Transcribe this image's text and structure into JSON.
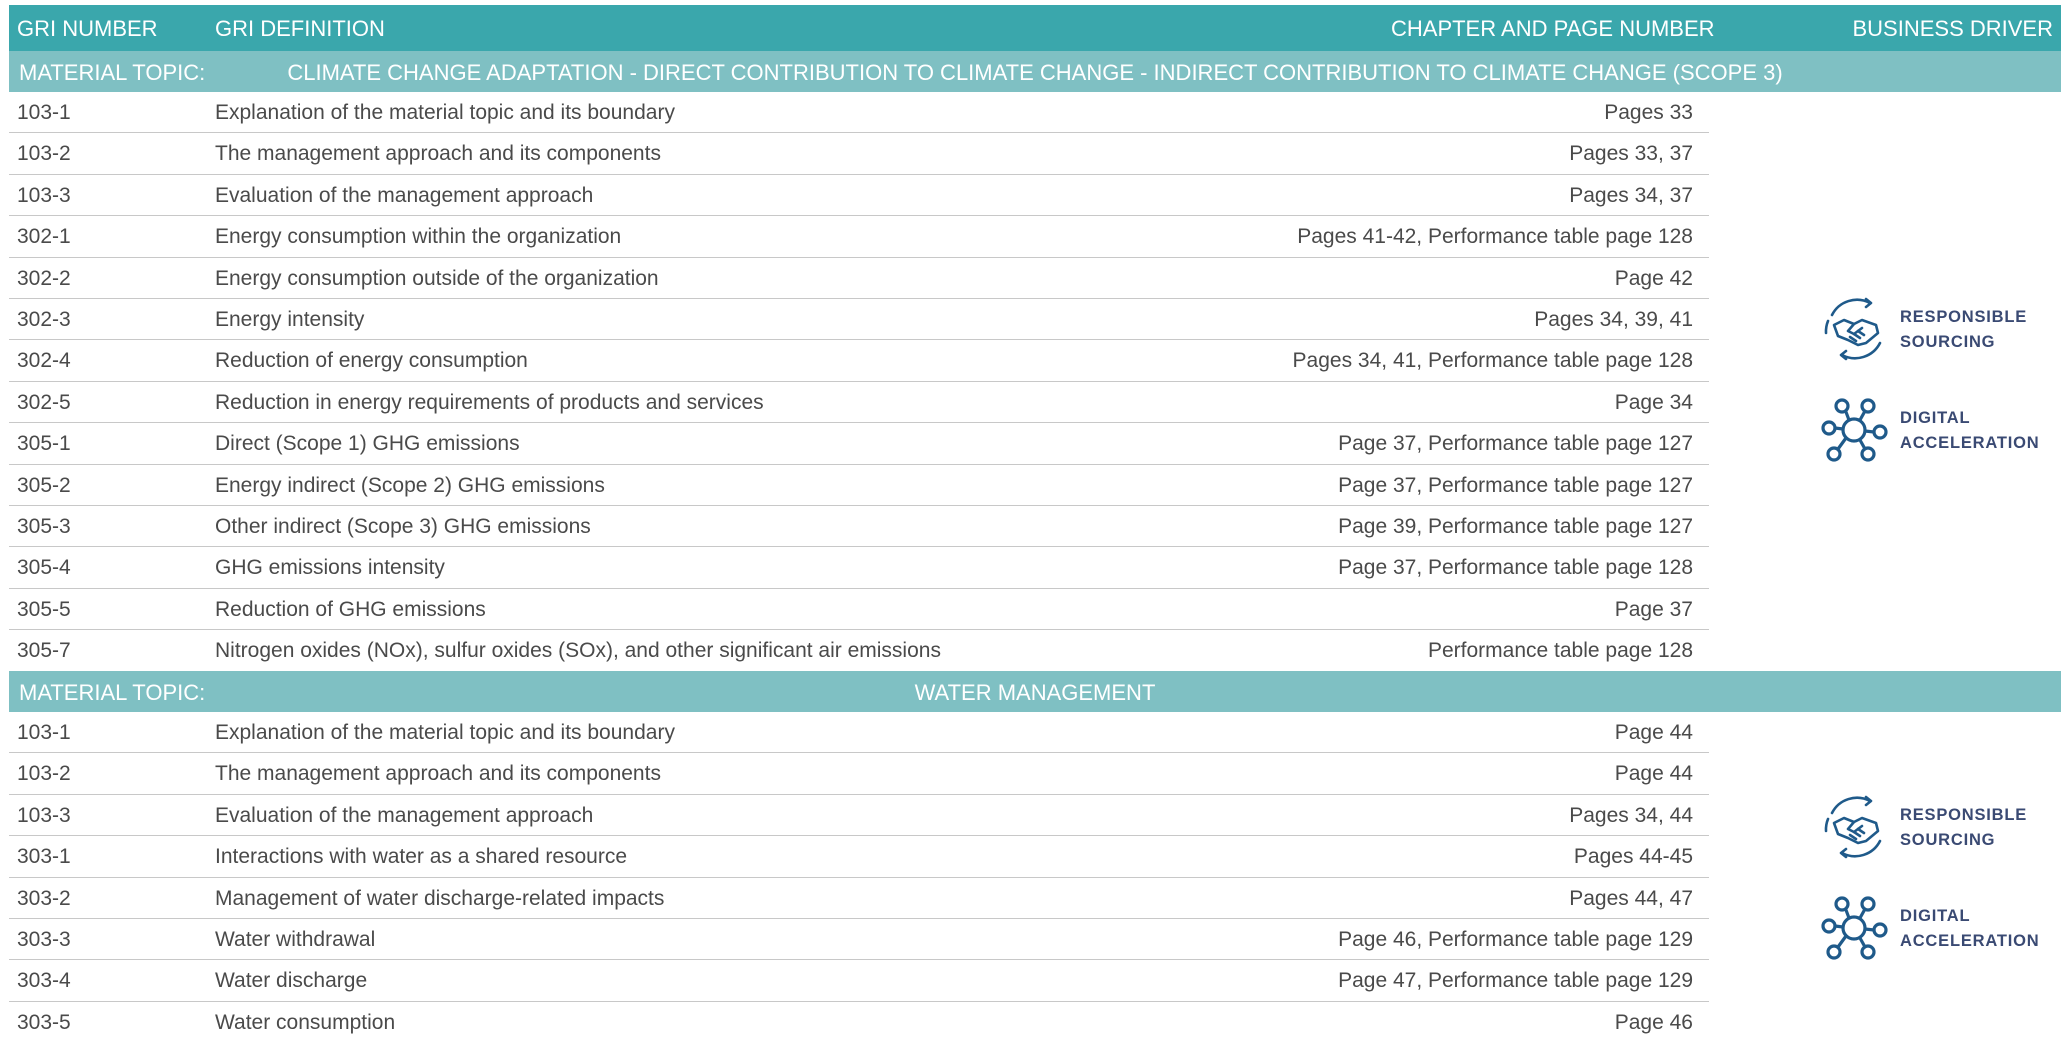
{
  "header": {
    "col1": "GRI NUMBER",
    "col2": "GRI DEFINITION",
    "col3": "CHAPTER AND PAGE NUMBER",
    "col4": "BUSINESS DRIVER"
  },
  "sections": [
    {
      "label": "MATERIAL TOPIC:",
      "title": "CLIMATE CHANGE ADAPTATION - DIRECT CONTRIBUTION TO CLIMATE CHANGE - INDIRECT CONTRIBUTION TO CLIMATE CHANGE (SCOPE 3)",
      "rows": [
        {
          "num": "103-1",
          "def": "Explanation of the material topic and its boundary",
          "page": "Pages 33"
        },
        {
          "num": "103-2",
          "def": "The management approach and its components",
          "page": "Pages 33, 37"
        },
        {
          "num": "103-3",
          "def": "Evaluation of the management approach",
          "page": "Pages 34, 37"
        },
        {
          "num": "302-1",
          "def": "Energy consumption within the organization",
          "page": "Pages 41-42, Performance table page 128"
        },
        {
          "num": "302-2",
          "def": "Energy consumption outside of the organization",
          "page": "Page 42"
        },
        {
          "num": "302-3",
          "def": "Energy intensity",
          "page": "Pages 34, 39, 41"
        },
        {
          "num": "302-4",
          "def": "Reduction of energy consumption",
          "page": "Pages 34, 41, Performance table page 128"
        },
        {
          "num": "302-5",
          "def": "Reduction in energy requirements of products and services",
          "page": "Page 34"
        },
        {
          "num": "305-1",
          "def": "Direct (Scope 1) GHG emissions",
          "page": "Page 37, Performance table page 127"
        },
        {
          "num": "305-2",
          "def": "Energy indirect (Scope 2) GHG emissions",
          "page": "Page 37, Performance table page 127"
        },
        {
          "num": "305-3",
          "def": "Other indirect (Scope 3) GHG emissions",
          "page": "Page 39, Performance table page 127"
        },
        {
          "num": "305-4",
          "def": "GHG emissions intensity",
          "page": "Page 37, Performance table page 128"
        },
        {
          "num": "305-5",
          "def": "Reduction of GHG emissions",
          "page": "Page 37"
        },
        {
          "num": "305-7",
          "def": "Nitrogen oxides (NOx), sulfur oxides (SOx), and other significant air emissions",
          "page": "Performance table page 128"
        }
      ],
      "drivers": [
        {
          "line1": "RESPONSIBLE",
          "line2": "SOURCING",
          "icon": "handshake-cycle-icon"
        },
        {
          "line1": "DIGITAL",
          "line2": "ACCELERATION",
          "icon": "network-nodes-icon"
        }
      ]
    },
    {
      "label": "MATERIAL TOPIC:",
      "title": "WATER MANAGEMENT",
      "rows": [
        {
          "num": "103-1",
          "def": "Explanation of the material topic and its boundary",
          "page": "Page 44"
        },
        {
          "num": "103-2",
          "def": "The management approach and its components",
          "page": "Page 44"
        },
        {
          "num": "103-3",
          "def": "Evaluation of the management approach",
          "page": "Pages 34, 44"
        },
        {
          "num": "303-1",
          "def": "Interactions with water as a shared resource",
          "page": "Pages 44-45"
        },
        {
          "num": "303-2",
          "def": "Management of water discharge-related impacts",
          "page": "Pages 44, 47"
        },
        {
          "num": "303-3",
          "def": "Water withdrawal",
          "page": "Page 46, Performance table page 129"
        },
        {
          "num": "303-4",
          "def": "Water discharge",
          "page": "Page 47, Performance table page 129"
        },
        {
          "num": "303-5",
          "def": "Water consumption",
          "page": "Page 46"
        }
      ],
      "drivers": [
        {
          "line1": "RESPONSIBLE",
          "line2": "SOURCING",
          "icon": "handshake-cycle-icon"
        },
        {
          "line1": "DIGITAL",
          "line2": "ACCELERATION",
          "icon": "network-nodes-icon"
        }
      ]
    }
  ],
  "colors": {
    "header": "#3aa7ac",
    "topic": "#7fc0c3",
    "driver_icon": "#1f5a8a",
    "driver_text": "#3a4a73"
  }
}
